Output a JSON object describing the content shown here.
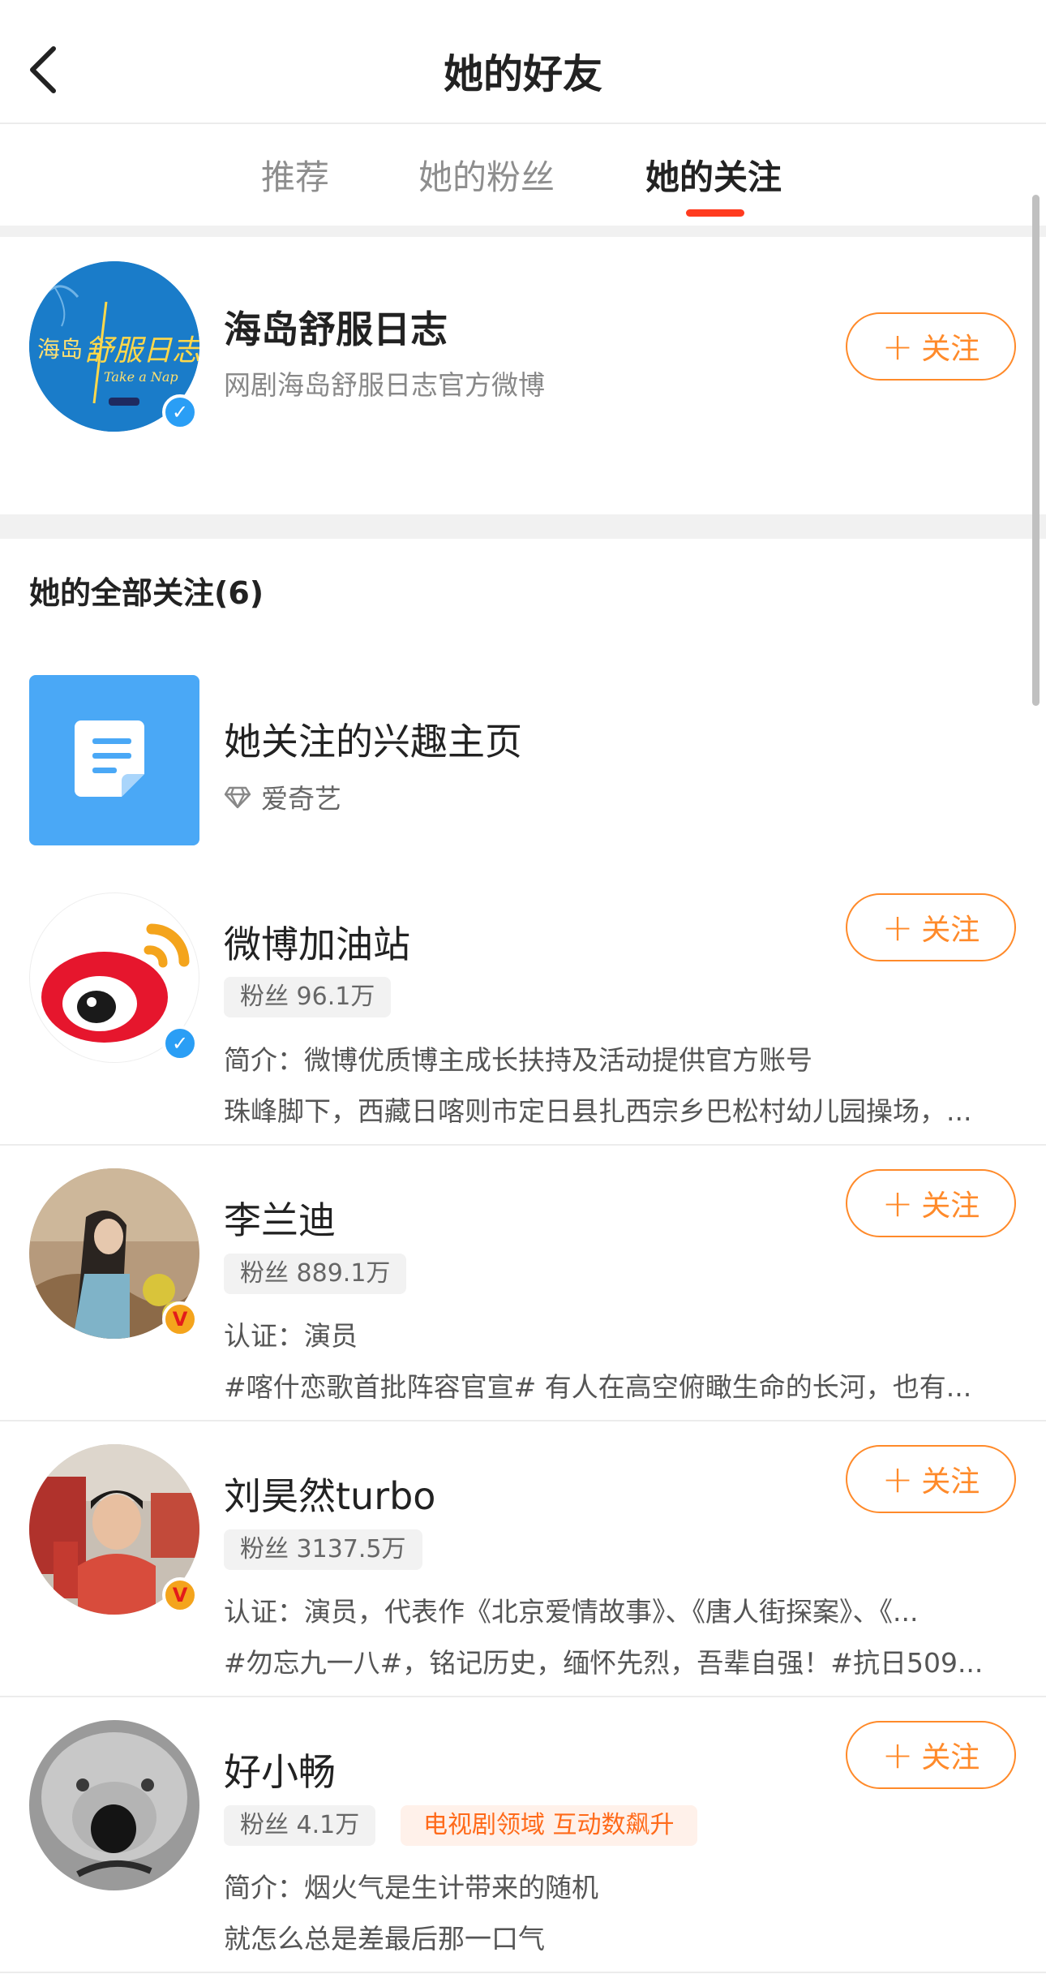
{
  "header": {
    "title": "她的好友"
  },
  "tabs": [
    {
      "label": "推荐",
      "active": false
    },
    {
      "label": "她的粉丝",
      "active": false
    },
    {
      "label": "她的关注",
      "active": true
    }
  ],
  "featured": {
    "name": "海岛舒服日志",
    "subtitle": "网剧海岛舒服日志官方微博",
    "avatar_text_1": "海岛",
    "avatar_text_2": "舒服日志",
    "avatar_text_3": "Take a Nap",
    "follow_label": "关注",
    "verified": "blue"
  },
  "section": {
    "title": "她的全部关注(6)"
  },
  "interest": {
    "title": "她关注的兴趣主页",
    "source": "爱奇艺"
  },
  "users": [
    {
      "name": "微博加油站",
      "fans": "粉丝 96.1万",
      "line1": "简介：微博优质博主成长扶持及活动提供官方账号",
      "line2": "珠峰脚下，西藏日喀则市定日县扎西宗乡巴松村幼儿园操场，...",
      "follow_label": "关注",
      "verified": "blue"
    },
    {
      "name": "李兰迪",
      "fans": "粉丝 889.1万",
      "line1": "认证：演员",
      "line2": "#喀什恋歌首批阵容官宣# 有人在高空俯瞰生命的长河，也有...",
      "follow_label": "关注",
      "verified": "orange"
    },
    {
      "name": "刘昊然turbo",
      "fans": "粉丝 3137.5万",
      "line1": "认证：演员，代表作《北京爱情故事》、《唐人街探案》、《...",
      "line2": "#勿忘九一八#，铭记历史，缅怀先烈，吾辈自强！#抗日509...",
      "follow_label": "关注",
      "verified": "orange"
    },
    {
      "name": "好小畅",
      "fans": "粉丝 4.1万",
      "tag": "电视剧领域 互动数飙升",
      "line1": "简介：烟火气是生计带来的随机",
      "line2": "就怎么总是差最后那一口气",
      "follow_label": "关注"
    }
  ],
  "colors": {
    "accent": "#ff8a2a",
    "tab_underline": "#ff3b1f",
    "verified_blue": "#2a9ef5",
    "verified_orange": "#f4a41c",
    "weibo_red": "#e6162d"
  }
}
